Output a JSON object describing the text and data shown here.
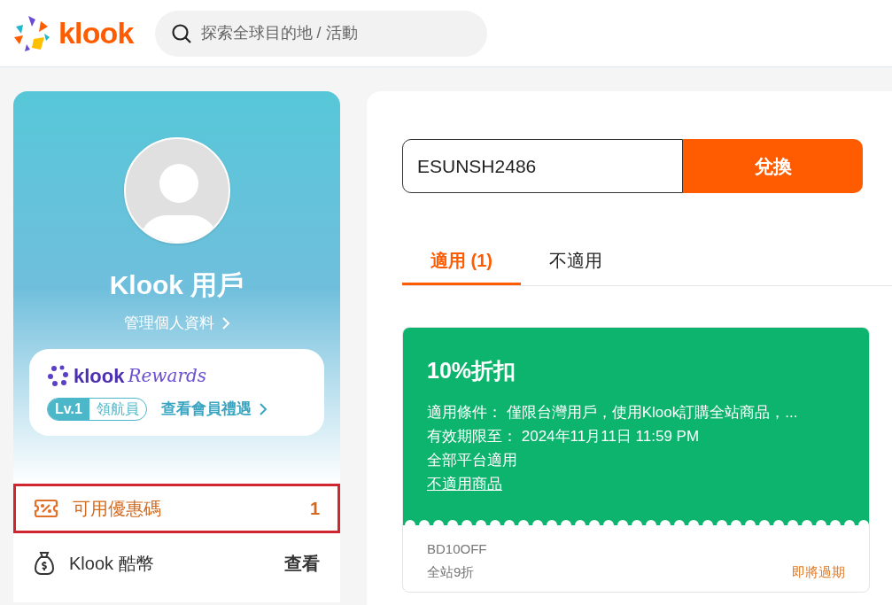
{
  "header": {
    "logo": "klook",
    "search": {
      "placeholder": "探索全球目的地 / 活動"
    }
  },
  "profile": {
    "name": "Klook 用戶",
    "manage_link": "管理個人資料",
    "rewards": {
      "brand": "klook",
      "brand_suffix": "Rewards",
      "level": "Lv.1",
      "tier": "領航員",
      "benefits_link": "查看會員禮遇"
    }
  },
  "menu": [
    {
      "kind": "coupon",
      "label": "可用優惠碼",
      "value": "1",
      "selected": true,
      "highlighted": true
    },
    {
      "kind": "coins",
      "label": "Klook 酷幣",
      "value": "查看",
      "selected": false,
      "highlighted": false
    }
  ],
  "redeem": {
    "value": "ESUNSH2486",
    "button": "兌換"
  },
  "tabs": [
    {
      "label": "適用 (1)",
      "selected": true
    },
    {
      "label": "不適用",
      "selected": false
    }
  ],
  "coupons": [
    {
      "title": "10%折扣",
      "conditions": "適用條件： 僅限台灣用戶，使用Klook訂購全站商品，...",
      "validity": "有效期限至： 2024年11月11日 11:59 PM",
      "platform": "全部平台適用",
      "link": "不適用商品",
      "code": "BD10OFF",
      "description": "全站9折",
      "status": "即將過期",
      "color": "#0db46e"
    }
  ]
}
